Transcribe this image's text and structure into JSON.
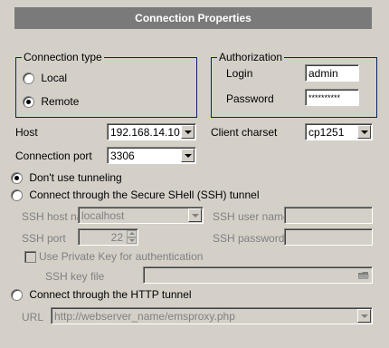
{
  "title": "Connection Properties",
  "connection_type": {
    "legend": "Connection type",
    "local_label": "Local",
    "remote_label": "Remote",
    "selected": "remote"
  },
  "authorization": {
    "legend": "Authorization",
    "login_label": "Login",
    "login_value": "admin",
    "password_label": "Password",
    "password_value": "**********"
  },
  "host": {
    "label": "Host",
    "value": "192.168.14.10"
  },
  "client_charset": {
    "label": "Client charset",
    "value": "cp1251"
  },
  "connection_port": {
    "label": "Connection port",
    "value": "3306"
  },
  "tunneling": {
    "none_label": "Don't use tunneling",
    "ssh_label": "Connect through the Secure SHell (SSH) tunnel",
    "http_label": "Connect through the HTTP tunnel",
    "selected": "none"
  },
  "ssh": {
    "host_label": "SSH host name",
    "host_value": "localhost",
    "user_label": "SSH user name",
    "user_value": "",
    "port_label": "SSH port",
    "port_value": "22",
    "password_label": "SSH password",
    "password_value": "",
    "private_key_label": "Use Private Key for authentication",
    "key_file_label": "SSH key file",
    "key_file_value": ""
  },
  "http": {
    "url_label": "URL",
    "url_value": "http://webserver_name/emsproxy.php"
  }
}
